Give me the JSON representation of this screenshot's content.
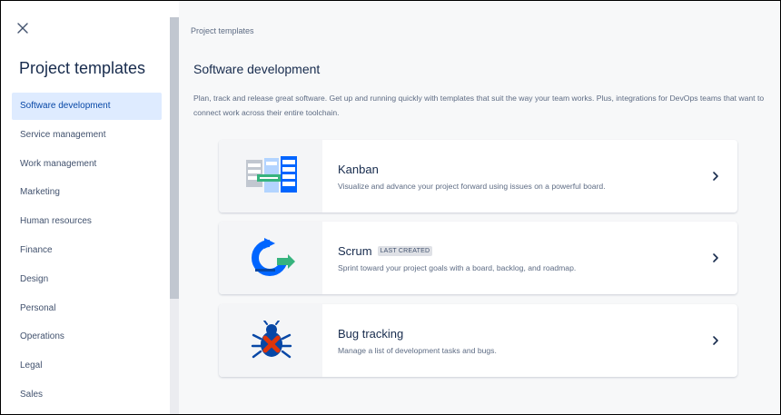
{
  "sidebar": {
    "title": "Project templates",
    "items": [
      {
        "label": "Software development",
        "active": true
      },
      {
        "label": "Service management"
      },
      {
        "label": "Work management"
      },
      {
        "label": "Marketing"
      },
      {
        "label": "Human resources"
      },
      {
        "label": "Finance"
      },
      {
        "label": "Design"
      },
      {
        "label": "Personal"
      },
      {
        "label": "Operations"
      },
      {
        "label": "Legal"
      },
      {
        "label": "Sales"
      }
    ]
  },
  "main": {
    "breadcrumb": "Project templates",
    "title": "Software development",
    "description": "Plan, track and release great software. Get up and running quickly with templates that suit the way your team works. Plus, integrations for DevOps teams that want to connect work across their entire toolchain.",
    "cards": [
      {
        "title": "Kanban",
        "badge": "",
        "description": "Visualize and advance your project forward using issues on a powerful board.",
        "icon": "kanban-board-icon"
      },
      {
        "title": "Scrum",
        "badge": "LAST CREATED",
        "description": "Sprint toward your project goals with a board, backlog, and roadmap.",
        "icon": "scrum-cycle-icon"
      },
      {
        "title": "Bug tracking",
        "badge": "",
        "description": "Manage a list of development tasks and bugs.",
        "icon": "bug-icon"
      }
    ]
  },
  "colors": {
    "active_nav_bg": "#deebff",
    "active_nav_text": "#0747a6",
    "accent_blue": "#0065ff",
    "accent_green": "#36b37e",
    "bug_red": "#de350b"
  }
}
